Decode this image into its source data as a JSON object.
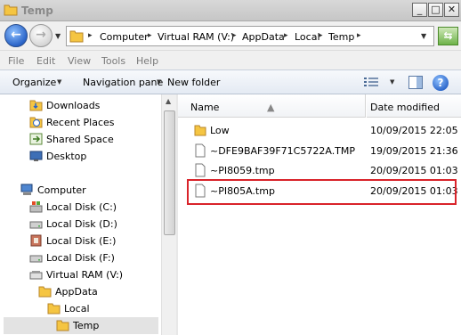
{
  "window": {
    "title": "Temp"
  },
  "address": {
    "crumbs": [
      "Computer",
      "Virtual RAM (V:)",
      "AppData",
      "Local",
      "Temp"
    ]
  },
  "menu": [
    "File",
    "Edit",
    "View",
    "Tools",
    "Help"
  ],
  "toolbar": {
    "organize": "Organize",
    "navigation_pane": "Navigation pane",
    "new_folder": "New folder"
  },
  "nav": {
    "items": [
      {
        "label": "Downloads",
        "icon": "downloads-folder-icon"
      },
      {
        "label": "Recent Places",
        "icon": "recent-places-icon"
      },
      {
        "label": "Shared Space",
        "icon": "shared-space-icon"
      },
      {
        "label": "Desktop",
        "icon": "desktop-icon"
      },
      {
        "label": "Computer",
        "icon": "computer-icon"
      },
      {
        "label": "Local Disk (C:)",
        "icon": "windows-drive-icon"
      },
      {
        "label": "Local Disk (D:)",
        "icon": "drive-icon"
      },
      {
        "label": "Local Disk (E:)",
        "icon": "drive-icon"
      },
      {
        "label": "Local Disk (F:)",
        "icon": "drive-icon"
      },
      {
        "label": "Virtual RAM (V:)",
        "icon": "ram-drive-icon"
      },
      {
        "label": "AppData",
        "icon": "folder-icon"
      },
      {
        "label": "Local",
        "icon": "folder-icon"
      },
      {
        "label": "Temp",
        "icon": "folder-icon",
        "selected": true
      }
    ]
  },
  "files": {
    "columns": {
      "name": "Name",
      "date": "Date modified"
    },
    "rows": [
      {
        "name": "Low",
        "date": "10/09/2015 22:05",
        "type": "folder"
      },
      {
        "name": "~DFE9BAF39F71C5722A.TMP",
        "date": "19/09/2015 21:36",
        "type": "file"
      },
      {
        "name": "~PI8059.tmp",
        "date": "20/09/2015 01:03",
        "type": "file"
      },
      {
        "name": "~PI805A.tmp",
        "date": "20/09/2015 01:03",
        "type": "file",
        "highlighted": true
      }
    ]
  },
  "colors": {
    "highlight_border": "#d9232a",
    "folder": "#f5c542"
  }
}
